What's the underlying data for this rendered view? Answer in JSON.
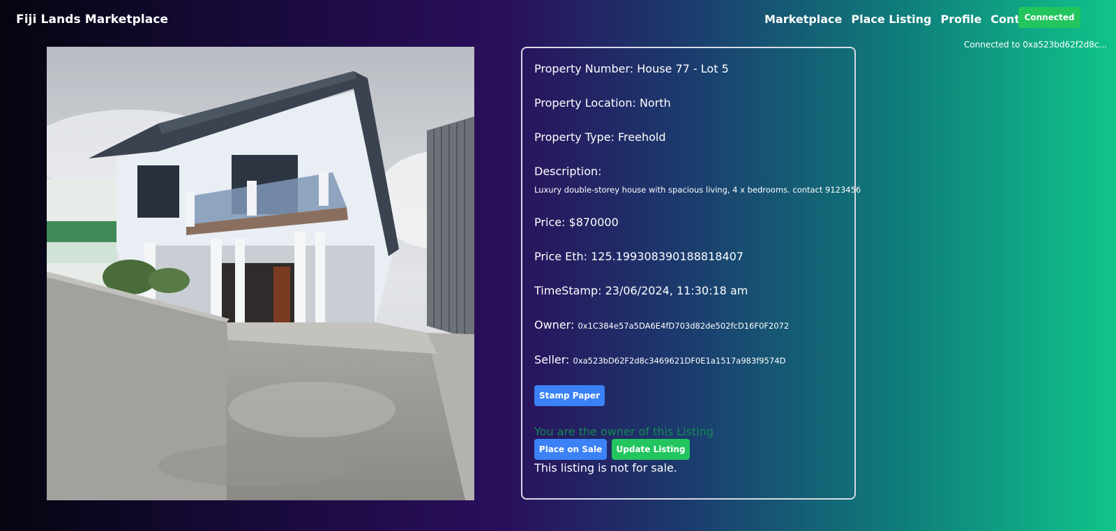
{
  "header": {
    "brand": "Fiji Lands Marketplace",
    "nav": [
      "Marketplace",
      "Place Listing",
      "Profile",
      "Contact Us"
    ],
    "connected_label": "Connected",
    "connected_to": "Connected to 0xa523bd62f2d8c..."
  },
  "listing": {
    "property_number": "Property Number: House 77 - Lot 5",
    "property_location": "Property Location: North",
    "property_type": "Property Type: Freehold",
    "description_label": "Description:",
    "description": "Luxury double-storey house with spacious living, 4 x bedrooms. contact 9123456",
    "price": "Price: $870000",
    "price_eth": "Price Eth: 125.199308390188818407",
    "timestamp": "TimeStamp: 23/06/2024, 11:30:18 am",
    "owner_label": "Owner:",
    "owner_address": "0x1C384e57a5DA6E4fD703d82de502fcD16F0F2072",
    "seller_label": "Seller:",
    "seller_address": "0xa523bD62F2d8c3469621DF0E1a1517a983f9574D",
    "stamp_paper_label": "Stamp Paper",
    "owner_message": "You are the owner of this Listing",
    "place_on_sale_label": "Place on Sale",
    "update_listing_label": "Update Listing",
    "sale_status": "This listing is not for sale."
  },
  "colors": {
    "primary_button": "#3b82f6",
    "success_button": "#22c55e",
    "owner_message": "#138a55"
  }
}
